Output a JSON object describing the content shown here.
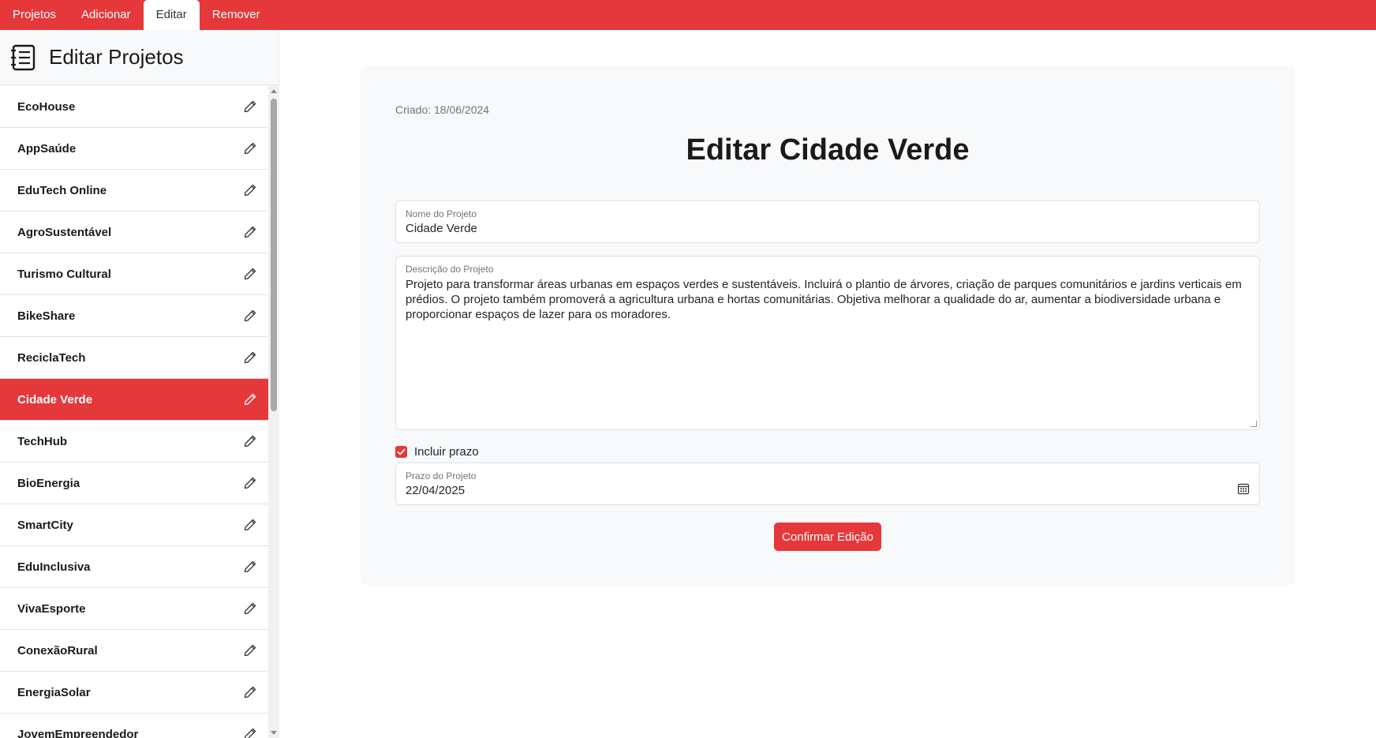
{
  "topnav": {
    "tabs": [
      {
        "label": "Projetos"
      },
      {
        "label": "Adicionar"
      },
      {
        "label": "Editar",
        "active": true
      },
      {
        "label": "Remover"
      }
    ]
  },
  "sidebar": {
    "title": "Editar Projetos",
    "icon": "list-document-icon",
    "items": [
      {
        "label": "EcoHouse"
      },
      {
        "label": "AppSaúde"
      },
      {
        "label": "EduTech Online"
      },
      {
        "label": "AgroSustentável"
      },
      {
        "label": "Turismo Cultural"
      },
      {
        "label": "BikeShare"
      },
      {
        "label": "ReciclaTech"
      },
      {
        "label": "Cidade Verde",
        "selected": true
      },
      {
        "label": "TechHub"
      },
      {
        "label": "BioEnergia"
      },
      {
        "label": "SmartCity"
      },
      {
        "label": "EduInclusiva"
      },
      {
        "label": "VivaEsporte"
      },
      {
        "label": "ConexãoRural"
      },
      {
        "label": "EnergiaSolar"
      },
      {
        "label": "JovemEmpreendedor"
      }
    ]
  },
  "main": {
    "created": "Criado: 18/06/2024",
    "title": "Editar Cidade Verde",
    "name_field": {
      "label": "Nome do Projeto",
      "value": "Cidade Verde"
    },
    "description_field": {
      "label": "Descrição do Projeto",
      "value": "Projeto para transformar áreas urbanas em espaços verdes e sustentáveis. Incluirá o plantio de árvores, criação de parques comunitários e jardins verticais em prédios. O projeto também promoverá a agricultura urbana e hortas comunitárias. Objetiva melhorar a qualidade do ar, aumentar a biodiversidade urbana e proporcionar espaços de lazer para os moradores."
    },
    "include_deadline": {
      "label": "Incluir prazo",
      "checked": true
    },
    "deadline_field": {
      "label": "Prazo do Projeto",
      "value": "22/04/2025"
    },
    "confirm_button": "Confirmar Edição"
  },
  "colors": {
    "accent": "#e5383b",
    "card_bg": "#f8f9fa",
    "text": "#212529",
    "muted": "#6c757d"
  }
}
